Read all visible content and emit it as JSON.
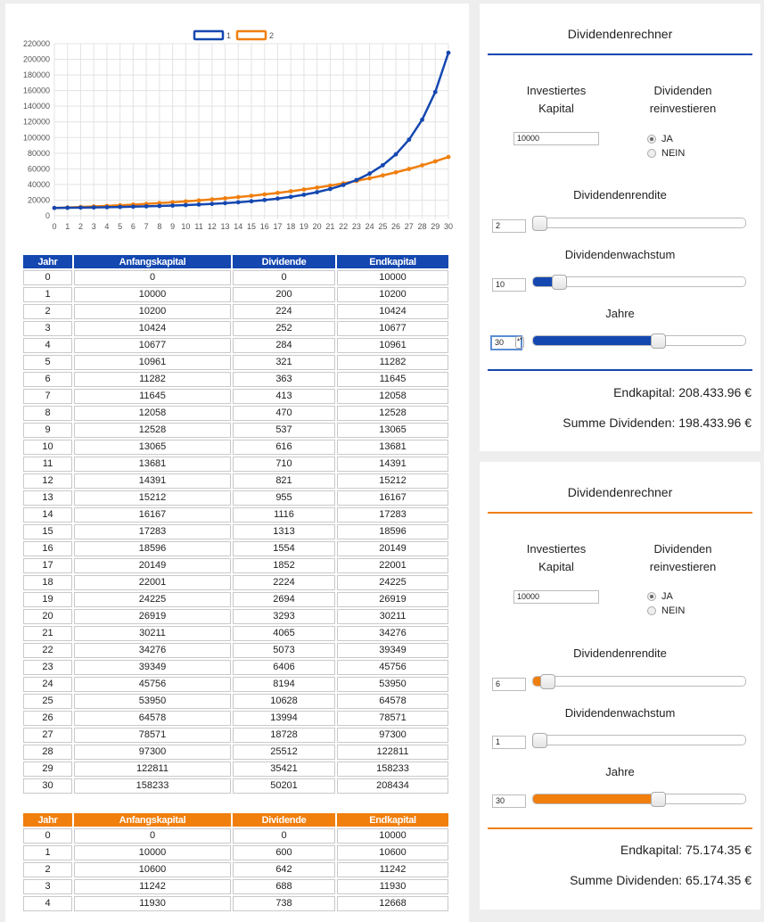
{
  "chart_data": {
    "type": "line",
    "legend": [
      "1",
      "2"
    ],
    "x": [
      0,
      1,
      2,
      3,
      4,
      5,
      6,
      7,
      8,
      9,
      10,
      11,
      12,
      13,
      14,
      15,
      16,
      17,
      18,
      19,
      20,
      21,
      22,
      23,
      24,
      25,
      26,
      27,
      28,
      29,
      30
    ],
    "series": [
      {
        "name": "1",
        "color": "#1447b0",
        "values": [
          10000,
          10200,
          10424,
          10677,
          10961,
          11282,
          11645,
          12058,
          12528,
          13065,
          13681,
          14391,
          15212,
          16167,
          17283,
          18596,
          20149,
          22001,
          24225,
          26919,
          30211,
          34276,
          39349,
          45756,
          53950,
          64578,
          78571,
          97300,
          122811,
          158233,
          208434
        ]
      },
      {
        "name": "2",
        "color": "#f07f0e",
        "values": [
          10000,
          10600,
          11242,
          11930,
          12668,
          13460,
          14310,
          15223,
          16204,
          17259,
          18394,
          19616,
          20932,
          22350,
          23880,
          25531,
          27314,
          29240,
          31322,
          33573,
          36009,
          38646,
          41503,
          44600,
          47958,
          51603,
          55559,
          59854,
          64521,
          69595,
          75174
        ]
      }
    ],
    "ylim": [
      0,
      220000
    ],
    "yticks": [
      0,
      20000,
      40000,
      60000,
      80000,
      100000,
      120000,
      140000,
      160000,
      180000,
      200000,
      220000
    ],
    "grid": true,
    "legend_position": "top"
  },
  "table_headers": [
    "Jahr",
    "Anfangskapital",
    "Dividende",
    "Endkapital"
  ],
  "table1_rows": [
    [
      "0",
      "0",
      "0",
      "10000"
    ],
    [
      "1",
      "10000",
      "200",
      "10200"
    ],
    [
      "2",
      "10200",
      "224",
      "10424"
    ],
    [
      "3",
      "10424",
      "252",
      "10677"
    ],
    [
      "4",
      "10677",
      "284",
      "10961"
    ],
    [
      "5",
      "10961",
      "321",
      "11282"
    ],
    [
      "6",
      "11282",
      "363",
      "11645"
    ],
    [
      "7",
      "11645",
      "413",
      "12058"
    ],
    [
      "8",
      "12058",
      "470",
      "12528"
    ],
    [
      "9",
      "12528",
      "537",
      "13065"
    ],
    [
      "10",
      "13065",
      "616",
      "13681"
    ],
    [
      "11",
      "13681",
      "710",
      "14391"
    ],
    [
      "12",
      "14391",
      "821",
      "15212"
    ],
    [
      "13",
      "15212",
      "955",
      "16167"
    ],
    [
      "14",
      "16167",
      "1116",
      "17283"
    ],
    [
      "15",
      "17283",
      "1313",
      "18596"
    ],
    [
      "16",
      "18596",
      "1554",
      "20149"
    ],
    [
      "17",
      "20149",
      "1852",
      "22001"
    ],
    [
      "18",
      "22001",
      "2224",
      "24225"
    ],
    [
      "19",
      "24225",
      "2694",
      "26919"
    ],
    [
      "20",
      "26919",
      "3293",
      "30211"
    ],
    [
      "21",
      "30211",
      "4065",
      "34276"
    ],
    [
      "22",
      "34276",
      "5073",
      "39349"
    ],
    [
      "23",
      "39349",
      "6406",
      "45756"
    ],
    [
      "24",
      "45756",
      "8194",
      "53950"
    ],
    [
      "25",
      "53950",
      "10628",
      "64578"
    ],
    [
      "26",
      "64578",
      "13994",
      "78571"
    ],
    [
      "27",
      "78571",
      "18728",
      "97300"
    ],
    [
      "28",
      "97300",
      "25512",
      "122811"
    ],
    [
      "29",
      "122811",
      "35421",
      "158233"
    ],
    [
      "30",
      "158233",
      "50201",
      "208434"
    ]
  ],
  "table2_rows": [
    [
      "0",
      "0",
      "0",
      "10000"
    ],
    [
      "1",
      "10000",
      "600",
      "10600"
    ],
    [
      "2",
      "10600",
      "642",
      "11242"
    ],
    [
      "3",
      "11242",
      "688",
      "11930"
    ],
    [
      "4",
      "11930",
      "738",
      "12668"
    ]
  ],
  "calc1": {
    "title": "Dividendenrechner",
    "accent": "#1447b0",
    "label_capital": "Investiertes Kapital",
    "label_reinvest": "Dividenden reinvestieren",
    "capital_value": "10000",
    "radio_yes": "JA",
    "radio_no": "NEIN",
    "reinvest_selected": "JA",
    "label_yield": "Dividendenrendite",
    "yield_value": "2",
    "yield_fraction": 0.0,
    "label_growth": "Dividendenwachstum",
    "growth_value": "10",
    "growth_fraction": 0.1,
    "label_years": "Jahre",
    "years_value": "30",
    "years_fraction": 0.6,
    "endkapital": "Endkapital: 208.433.96 €",
    "summe": "Summe Dividenden: 198.433.96 €"
  },
  "calc2": {
    "title": "Dividendenrechner",
    "accent": "#f07f0e",
    "label_capital": "Investiertes Kapital",
    "label_reinvest": "Dividenden reinvestieren",
    "capital_value": "10000",
    "radio_yes": "JA",
    "radio_no": "NEIN",
    "reinvest_selected": "JA",
    "label_yield": "Dividendenrendite",
    "yield_value": "6",
    "yield_fraction": 0.04,
    "label_growth": "Dividendenwachstum",
    "growth_value": "1",
    "growth_fraction": 0.0,
    "label_years": "Jahre",
    "years_value": "30",
    "years_fraction": 0.6,
    "endkapital": "Endkapital: 75.174.35 €",
    "summe": "Summe Dividenden: 65.174.35 €"
  }
}
